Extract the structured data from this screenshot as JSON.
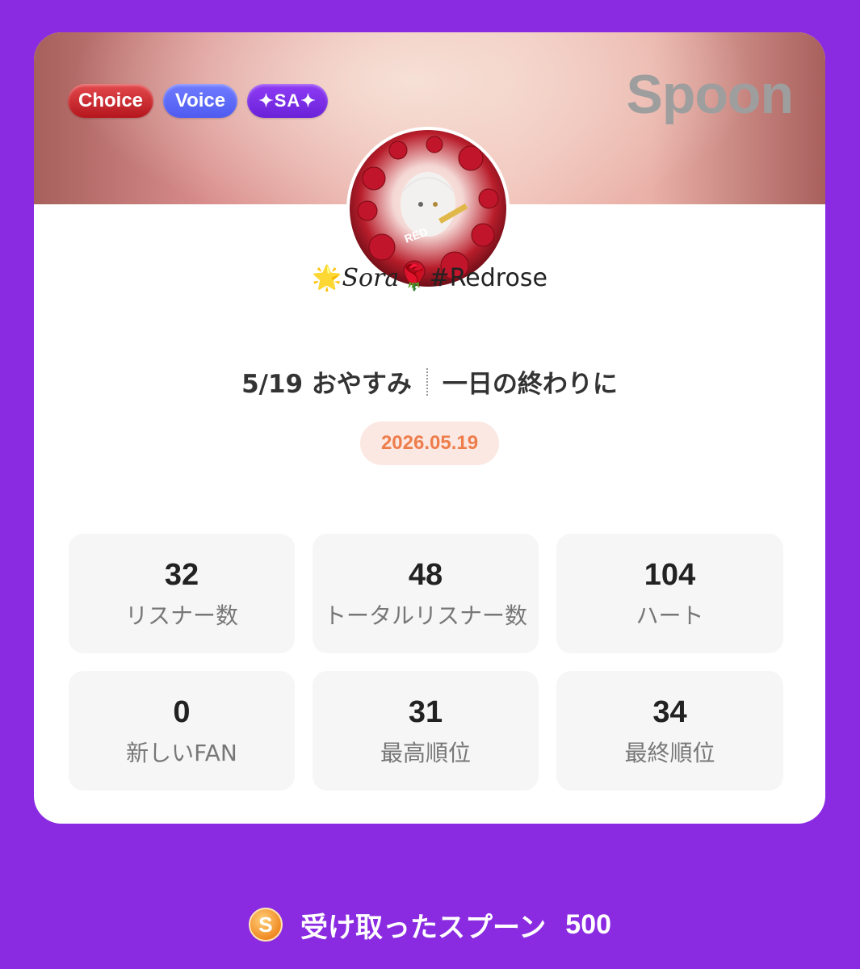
{
  "card": {
    "badges": [
      "Choice",
      "Voice",
      "✦SA✦"
    ],
    "logo": "Spoon",
    "user": {
      "star": "🌟",
      "name": "Sora",
      "rose": "🌹",
      "tag": "#Redrose"
    },
    "title_left": "5/19 おやすみ",
    "title_right": "一日の終わりに",
    "date": "2026.05.19",
    "stats": [
      {
        "value": "32",
        "label": "リスナー数"
      },
      {
        "value": "48",
        "label": "トータルリスナー数"
      },
      {
        "value": "104",
        "label": "ハート"
      },
      {
        "value": "0",
        "label": "新しいFAN"
      },
      {
        "value": "31",
        "label": "最高順位"
      },
      {
        "value": "34",
        "label": "最終順位"
      }
    ]
  },
  "footer": {
    "coin_letter": "S",
    "label": "受け取ったスプーン",
    "value": "500"
  },
  "colors": {
    "background": "#8a2be2",
    "date_text": "#ee7d4b",
    "date_bg": "#fbe8e2"
  }
}
